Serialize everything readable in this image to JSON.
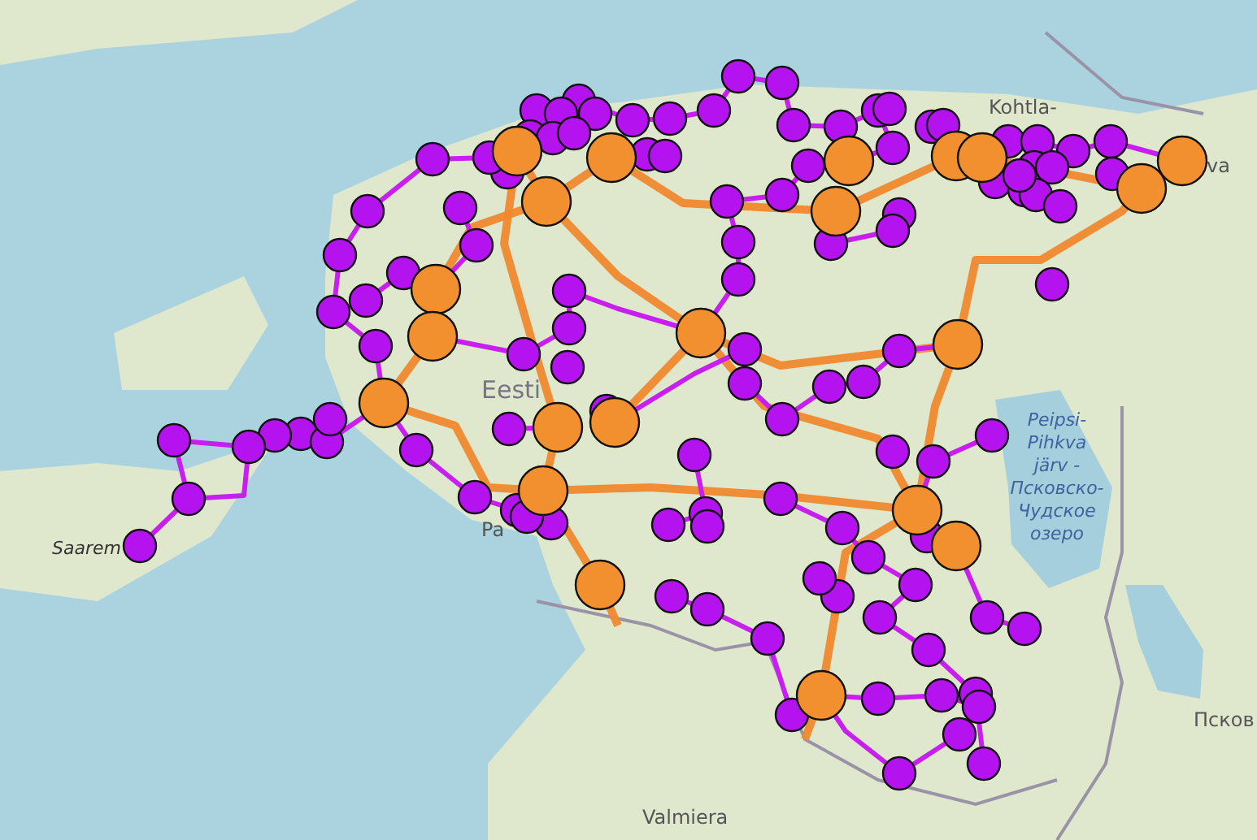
{
  "map": {
    "labels": [
      {
        "kind": "town",
        "lines": [
          "Kohtla-"
        ]
      },
      {
        "kind": "town",
        "lines": [
          "va"
        ]
      },
      {
        "kind": "country",
        "lines": [
          "Eesti"
        ]
      },
      {
        "kind": "island",
        "lines": [
          "Saarem"
        ]
      },
      {
        "kind": "town",
        "lines": [
          "Pa"
        ]
      },
      {
        "kind": "lake",
        "lines": [
          "Peipsi-",
          "Pihkva",
          "järv -",
          "Псковско-",
          "Чудское",
          "озеро"
        ]
      },
      {
        "kind": "city",
        "lines": [
          "Псков"
        ]
      },
      {
        "kind": "city",
        "lines": [
          "Valmiera"
        ]
      }
    ]
  },
  "network": {
    "routes": [
      {
        "kind": "trunk"
      },
      {
        "kind": "trunk"
      },
      {
        "kind": "trunk"
      },
      {
        "kind": "trunk"
      },
      {
        "kind": "trunk"
      },
      {
        "kind": "trunk"
      },
      {
        "kind": "trunk"
      },
      {
        "kind": "trunk"
      },
      {
        "kind": "trunk"
      },
      {
        "kind": "trunk"
      },
      {
        "kind": "branch"
      },
      {
        "kind": "branch"
      },
      {
        "kind": "branch"
      },
      {
        "kind": "branch"
      },
      {
        "kind": "branch"
      },
      {
        "kind": "branch"
      },
      {
        "kind": "branch"
      },
      {
        "kind": "branch"
      },
      {
        "kind": "branch"
      },
      {
        "kind": "branch"
      },
      {
        "kind": "branch"
      },
      {
        "kind": "branch"
      },
      {
        "kind": "branch"
      },
      {
        "kind": "branch"
      },
      {
        "kind": "branch"
      },
      {
        "kind": "branch"
      },
      {
        "kind": "branch"
      },
      {
        "kind": "branch"
      },
      {
        "kind": "branch"
      }
    ],
    "nodes": [
      {
        "kind": "major"
      },
      {
        "kind": "major"
      },
      {
        "kind": "major"
      },
      {
        "kind": "major"
      },
      {
        "kind": "major"
      },
      {
        "kind": "major"
      },
      {
        "kind": "major"
      },
      {
        "kind": "major"
      },
      {
        "kind": "major"
      },
      {
        "kind": "major"
      },
      {
        "kind": "major"
      },
      {
        "kind": "major"
      },
      {
        "kind": "major"
      },
      {
        "kind": "major"
      },
      {
        "kind": "major"
      },
      {
        "kind": "major"
      },
      {
        "kind": "major"
      },
      {
        "kind": "major"
      },
      {
        "kind": "major"
      },
      {
        "kind": "major"
      },
      {
        "kind": "major"
      },
      {
        "kind": "minor"
      },
      {
        "kind": "minor"
      },
      {
        "kind": "minor"
      },
      {
        "kind": "minor"
      },
      {
        "kind": "minor"
      },
      {
        "kind": "minor"
      },
      {
        "kind": "minor"
      },
      {
        "kind": "minor"
      },
      {
        "kind": "minor"
      },
      {
        "kind": "minor"
      },
      {
        "kind": "minor"
      },
      {
        "kind": "minor"
      },
      {
        "kind": "minor"
      },
      {
        "kind": "minor"
      },
      {
        "kind": "minor"
      },
      {
        "kind": "minor"
      },
      {
        "kind": "minor"
      },
      {
        "kind": "minor"
      },
      {
        "kind": "minor"
      },
      {
        "kind": "minor"
      },
      {
        "kind": "minor"
      },
      {
        "kind": "minor"
      },
      {
        "kind": "minor"
      },
      {
        "kind": "minor"
      },
      {
        "kind": "minor"
      },
      {
        "kind": "minor"
      },
      {
        "kind": "minor"
      },
      {
        "kind": "minor"
      },
      {
        "kind": "minor"
      },
      {
        "kind": "minor"
      },
      {
        "kind": "minor"
      },
      {
        "kind": "minor"
      },
      {
        "kind": "minor"
      },
      {
        "kind": "minor"
      },
      {
        "kind": "minor"
      },
      {
        "kind": "minor"
      },
      {
        "kind": "minor"
      },
      {
        "kind": "minor"
      },
      {
        "kind": "minor"
      },
      {
        "kind": "minor"
      },
      {
        "kind": "minor"
      },
      {
        "kind": "minor"
      },
      {
        "kind": "minor"
      },
      {
        "kind": "minor"
      },
      {
        "kind": "minor"
      },
      {
        "kind": "minor"
      },
      {
        "kind": "minor"
      },
      {
        "kind": "minor"
      },
      {
        "kind": "minor"
      },
      {
        "kind": "minor"
      },
      {
        "kind": "minor"
      },
      {
        "kind": "minor"
      },
      {
        "kind": "minor"
      },
      {
        "kind": "minor"
      },
      {
        "kind": "minor"
      },
      {
        "kind": "minor"
      },
      {
        "kind": "minor"
      },
      {
        "kind": "minor"
      },
      {
        "kind": "minor"
      },
      {
        "kind": "minor"
      },
      {
        "kind": "minor"
      },
      {
        "kind": "minor"
      },
      {
        "kind": "minor"
      },
      {
        "kind": "minor"
      },
      {
        "kind": "minor"
      },
      {
        "kind": "minor"
      },
      {
        "kind": "minor"
      },
      {
        "kind": "minor"
      },
      {
        "kind": "minor"
      },
      {
        "kind": "minor"
      },
      {
        "kind": "minor"
      },
      {
        "kind": "minor"
      },
      {
        "kind": "minor"
      },
      {
        "kind": "minor"
      },
      {
        "kind": "minor"
      },
      {
        "kind": "minor"
      },
      {
        "kind": "minor"
      },
      {
        "kind": "minor"
      },
      {
        "kind": "minor"
      },
      {
        "kind": "minor"
      },
      {
        "kind": "minor"
      },
      {
        "kind": "minor"
      },
      {
        "kind": "minor"
      },
      {
        "kind": "minor"
      },
      {
        "kind": "minor"
      },
      {
        "kind": "minor"
      },
      {
        "kind": "minor"
      },
      {
        "kind": "minor"
      },
      {
        "kind": "minor"
      },
      {
        "kind": "minor"
      },
      {
        "kind": "minor"
      },
      {
        "kind": "minor"
      },
      {
        "kind": "minor"
      },
      {
        "kind": "minor"
      },
      {
        "kind": "minor"
      },
      {
        "kind": "minor"
      },
      {
        "kind": "minor"
      },
      {
        "kind": "minor"
      },
      {
        "kind": "minor"
      },
      {
        "kind": "minor"
      },
      {
        "kind": "minor"
      },
      {
        "kind": "minor"
      },
      {
        "kind": "minor"
      },
      {
        "kind": "minor"
      },
      {
        "kind": "minor"
      },
      {
        "kind": "minor"
      },
      {
        "kind": "minor"
      }
    ]
  }
}
